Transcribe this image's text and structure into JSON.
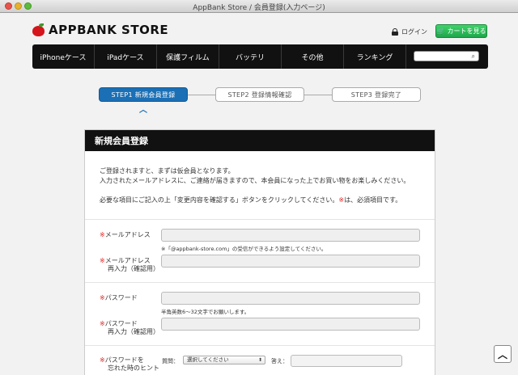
{
  "window": {
    "title": "AppBank Store / 会員登録(入力ページ)"
  },
  "header": {
    "logo_text": "APPBANK STORE",
    "login_label": "ログイン",
    "cart_label": "カートを見る",
    "cart_color": "#2db852"
  },
  "nav": {
    "items": [
      "iPhoneケース",
      "iPadケース",
      "保護フィルム",
      "バッテリ",
      "その他",
      "ランキング"
    ]
  },
  "steps": [
    {
      "label": "STEP1  新規会員登録",
      "active": true
    },
    {
      "label": "STEP2  登録情報確認",
      "active": false
    },
    {
      "label": "STEP3  登録完了",
      "active": false
    }
  ],
  "panel": {
    "title": "新規会員登録",
    "intro_line1": "ご登録されますと、まずは仮会員となります。",
    "intro_line2": "入力されたメールアドレスに、ご連絡が届きますので、本会員になった上でお買い物をお楽しみください。",
    "intro_line3_a": "必要な項目にご記入の上「変更内容を確認する」ボタンをクリックしてください。",
    "intro_line3_req": "※",
    "intro_line3_b": "は、必須項目です。"
  },
  "form": {
    "required_mark": "※",
    "email_label": "メールアドレス",
    "email_note": "※「@appbank-store.com」の受信ができるよう設定してください。",
    "email_confirm_label": "メールアドレス",
    "email_confirm_sub": "再入力（確認用）",
    "password_label": "パスワード",
    "password_note": "半角英数6〜32文字でお願いします。",
    "password_confirm_label": "パスワード",
    "password_confirm_sub": "再入力（確認用）",
    "hint_label": "パスワードを",
    "hint_sub": "忘れた時のヒント",
    "hint_question_label": "質問：",
    "hint_select_value": "選択してください",
    "hint_answer_label": "答え："
  }
}
